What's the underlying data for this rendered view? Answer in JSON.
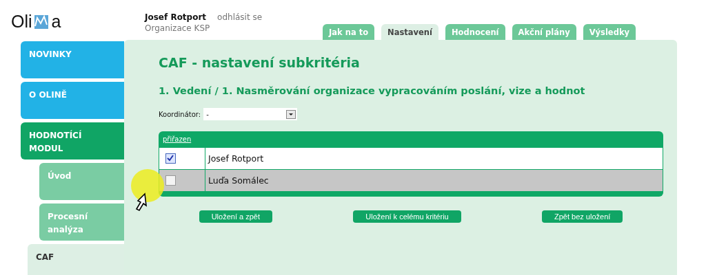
{
  "logo": {
    "before": "Oli",
    "after": "a"
  },
  "user": {
    "name": "Josef Rotport",
    "logout": "odhlásit se",
    "organization": "Organizace KSP"
  },
  "tabs": [
    {
      "label": "Jak na to",
      "selected": false
    },
    {
      "label": "Nastavení",
      "selected": true
    },
    {
      "label": "Hodnocení",
      "selected": false
    },
    {
      "label": "Akční plány",
      "selected": false
    },
    {
      "label": "Výsledky",
      "selected": false
    }
  ],
  "sidebar": {
    "items": [
      {
        "label": "NOVINKY",
        "kind": "section",
        "selected": false
      },
      {
        "label": "O OLINĚ",
        "kind": "section",
        "selected": false
      },
      {
        "label": "HODNOTÍCÍ MODUL",
        "kind": "module",
        "selected": false
      },
      {
        "label": "Úvod",
        "kind": "sub",
        "selected": false
      },
      {
        "label": "Procesní analýza",
        "kind": "sub",
        "selected": false
      },
      {
        "label": "CAF",
        "kind": "sub",
        "selected": true
      }
    ]
  },
  "title": "CAF - nastavení subkritéria",
  "subtitle": "1. Vedení / 1. Nasměrování organizace vypracováním poslání, vize a hodnot",
  "coordinator": {
    "label": "Koordinátor:",
    "value": "-"
  },
  "table": {
    "header": "přiřazen",
    "rows": [
      {
        "name": "Josef Rotport",
        "checked": true,
        "selected": false
      },
      {
        "name": "Luďa Somálec",
        "checked": false,
        "selected": true
      }
    ]
  },
  "buttons": [
    "Uložení a zpět",
    "Uložení k celému kritériu",
    "Zpět bez uložení"
  ]
}
